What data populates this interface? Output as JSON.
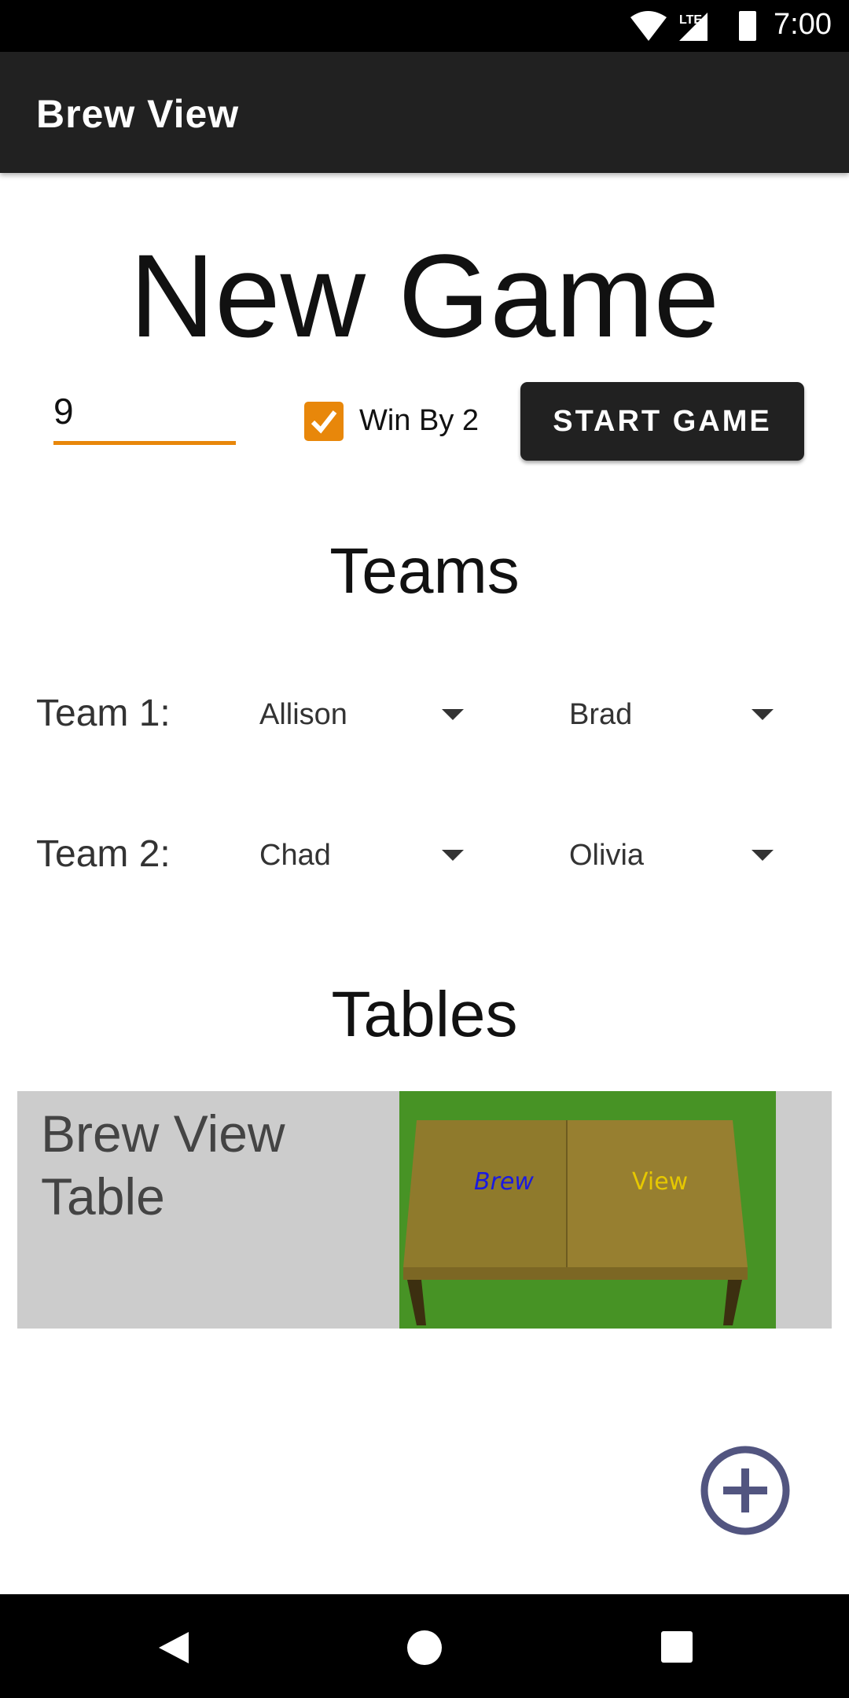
{
  "status_bar": {
    "time": "7:00",
    "network": "LTE",
    "icons": [
      "wifi-icon",
      "lte-signal-icon",
      "battery-icon"
    ]
  },
  "app_bar": {
    "title": "Brew View"
  },
  "heading": "New Game",
  "settings": {
    "points_value": "9",
    "win_by_2_label": "Win By 2",
    "win_by_2_checked": true,
    "start_label": "START GAME",
    "accent": "#e8870a"
  },
  "teams": {
    "heading": "Teams",
    "rows": [
      {
        "label": "Team 1:",
        "player1": "Allison",
        "player2": "Brad"
      },
      {
        "label": "Team 2:",
        "player1": "Chad",
        "player2": "Olivia"
      }
    ]
  },
  "tables": {
    "heading": "Tables",
    "items": [
      {
        "name": "Brew View Table",
        "image_text_left": "Brew",
        "image_text_right": "View"
      }
    ]
  },
  "fab": {
    "icon": "add-circle-icon",
    "color": "#525580"
  },
  "nav": {
    "icons": [
      "back-icon",
      "home-icon",
      "recents-icon"
    ]
  }
}
